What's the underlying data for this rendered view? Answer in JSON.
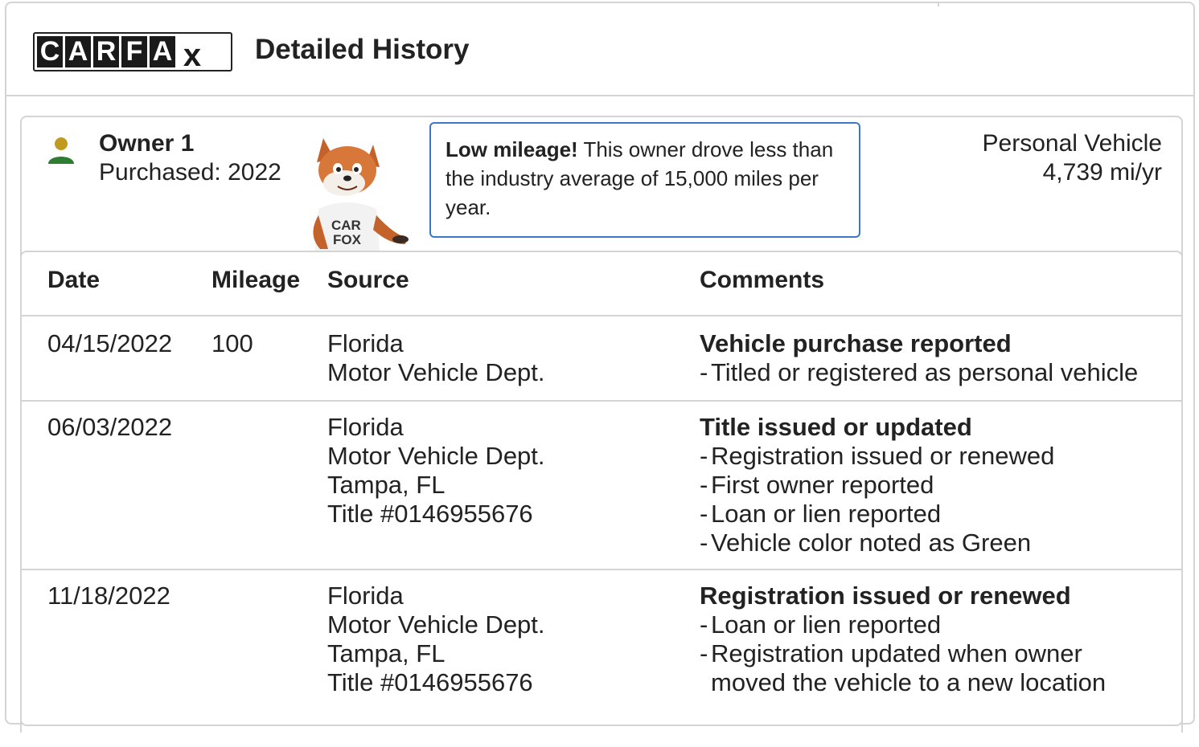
{
  "header": {
    "logo_letters": [
      "C",
      "A",
      "R",
      "F",
      "A",
      "x"
    ],
    "title": "Detailed History"
  },
  "owner": {
    "title": "Owner 1",
    "purchased": "Purchased: 2022",
    "icon": "person-icon",
    "icon_colors": {
      "head": "#c29a1e",
      "body": "#2e7d32"
    },
    "callout_bold": "Low mileage!",
    "callout_text": " This owner drove less than the industry average of 15,000 miles per year.",
    "vehicle_type": "Personal Vehicle",
    "mileage_per_year": "4,739 mi/yr",
    "mascot_shirt_text": "CAR FOX"
  },
  "table": {
    "columns": [
      "Date",
      "Mileage",
      "Source",
      "Comments"
    ],
    "rows": [
      {
        "date": "04/15/2022",
        "mileage": "100",
        "source": [
          "Florida",
          "Motor Vehicle Dept."
        ],
        "comment_title": "Vehicle purchase reported",
        "comment_items": [
          "Titled or registered as personal vehicle"
        ]
      },
      {
        "date": "06/03/2022",
        "mileage": "",
        "source": [
          "Florida",
          "Motor Vehicle Dept.",
          "Tampa, FL",
          "Title #0146955676"
        ],
        "comment_title": "Title issued or updated",
        "comment_items": [
          "Registration issued or renewed",
          "First owner reported",
          "Loan or lien reported",
          "Vehicle color noted as Green"
        ]
      },
      {
        "date": "11/18/2022",
        "mileage": "",
        "source": [
          "Florida",
          "Motor Vehicle Dept.",
          "Tampa, FL",
          "Title #0146955676"
        ],
        "comment_title": "Registration issued or renewed",
        "comment_items": [
          "Loan or lien reported",
          "Registration updated when owner",
          "moved the vehicle to a new location"
        ]
      }
    ]
  },
  "colors": {
    "callout_border": "#3a78c8",
    "divider": "#d4d4d4",
    "text": "#222222"
  }
}
